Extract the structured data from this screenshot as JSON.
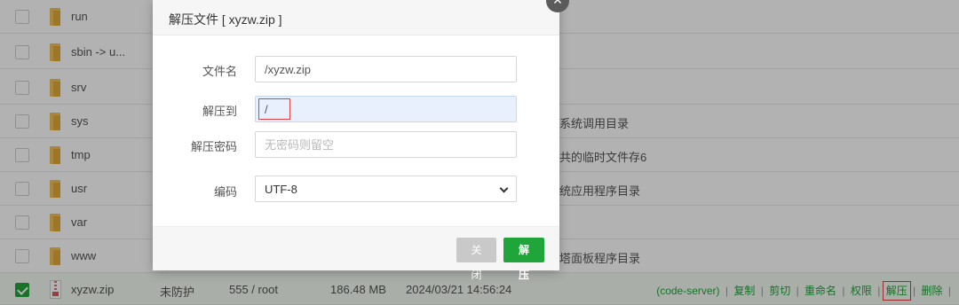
{
  "rows": [
    {
      "name": "run",
      "note": "",
      "type": "folder"
    },
    {
      "name": "sbin -> u...",
      "note": "",
      "type": "folder"
    },
    {
      "name": "srv",
      "note": "",
      "type": "folder"
    },
    {
      "name": "sys",
      "note": "系统调用目录",
      "type": "folder"
    },
    {
      "name": "tmp",
      "note": "共的临时文件存6",
      "type": "folder"
    },
    {
      "name": "usr",
      "note": "统应用程序目录",
      "type": "folder"
    },
    {
      "name": "var",
      "note": "",
      "type": "folder"
    },
    {
      "name": "www",
      "note": "塔面板程序目录",
      "type": "folder"
    }
  ],
  "selected_row": {
    "name": "xyzw.zip",
    "protect": "未防护",
    "perm": "555 / root",
    "size": "186.48 MB",
    "mtime": "2024/03/21 14:56:24",
    "ops": {
      "code_server": "(code-server)",
      "copy": "复制",
      "cut": "剪切",
      "rename": "重命名",
      "perm": "权限",
      "unzip": "解压",
      "delete": "删除"
    }
  },
  "dialog": {
    "title": "解压文件 [ xyzw.zip ]",
    "close_glyph": "×",
    "filename_label": "文件名",
    "filename_value": "/xyzw.zip",
    "unzip_to_label": "解压到",
    "unzip_to_value": "/",
    "password_label": "解压密码",
    "password_placeholder": "无密码则留空",
    "encoding_label": "编码",
    "encoding_value": "UTF-8",
    "cancel_button": "关闭",
    "confirm_button": "解压"
  },
  "colors": {
    "accent": "#20a53a",
    "highlight": "#e04040",
    "folder": "#f1c15c"
  }
}
